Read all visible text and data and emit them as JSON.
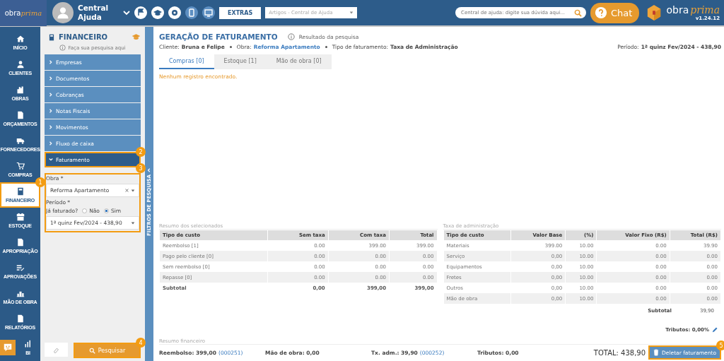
{
  "header": {
    "logo": {
      "part1": "obra",
      "part2": "prima"
    },
    "user": "Central Ajuda",
    "extras_button": "EXTRAS",
    "articles_select": {
      "placeholder": "Artigos - Central de Ajuda"
    },
    "help_search": {
      "placeholder": "Central de ajuda: digite sua dúvida aqui..."
    },
    "chat_button": "Chat",
    "brand": {
      "part1": "obra",
      "part2": "prima"
    },
    "version": "v1.24.12"
  },
  "nav": [
    {
      "label": "INÍCIO",
      "selected": false
    },
    {
      "label": "CLIENTES",
      "selected": false
    },
    {
      "label": "OBRAS",
      "selected": false
    },
    {
      "label": "ORÇAMENTOS",
      "selected": false
    },
    {
      "label": "FORNECEDORES",
      "selected": false
    },
    {
      "label": "COMPRAS",
      "selected": false
    },
    {
      "label": "FINANCEIRO",
      "selected": true,
      "callout": "1"
    },
    {
      "label": "ESTOQUE",
      "selected": false
    },
    {
      "label": "APROPRIAÇÃO",
      "selected": false
    },
    {
      "label": "APROVAÇÕES",
      "selected": false
    },
    {
      "label": "MÃO DE OBRA",
      "selected": false
    },
    {
      "label": "RELATÓRIOS",
      "selected": false
    },
    {
      "label": "BI",
      "selected": false
    }
  ],
  "sidebar": {
    "title": "FINANCEIRO",
    "hint": "Faça sua pesquisa aqui",
    "sections": [
      {
        "label": "Empresas",
        "expanded": false
      },
      {
        "label": "Documentos",
        "expanded": false
      },
      {
        "label": "Cobranças",
        "expanded": false
      },
      {
        "label": "Notas Fiscais",
        "expanded": false
      },
      {
        "label": "Movimentos",
        "expanded": false
      },
      {
        "label": "Fluxo de caixa",
        "expanded": false
      },
      {
        "label": "Faturamento",
        "expanded": true,
        "callout": "2"
      }
    ],
    "form": {
      "callout": "3",
      "obra_label": "Obra *",
      "obra_value": "Reforma Apartamento",
      "periodo_label": "Período *",
      "faturado_label": "Já faturado?",
      "faturado_options": [
        {
          "label": "Não",
          "selected": false
        },
        {
          "label": "Sim",
          "selected": true
        }
      ],
      "periodo_value": "1ª quinz Fev/2024 - 438,90"
    },
    "search_button": {
      "label": "Pesquisar",
      "callout": "4"
    },
    "side_tab": "FILTROS DE PESQUISA"
  },
  "main": {
    "title": "GERAÇÃO DE FATURAMENTO",
    "info": "Resultado da pesquisa",
    "meta": [
      {
        "label": "Cliente:",
        "value": "Bruna e Felipe",
        "link": false
      },
      {
        "label": "Obra:",
        "value": "Reforma Apartamento",
        "link": true
      },
      {
        "label": "Tipo de faturamento:",
        "value": "Taxa de Administração",
        "link": false
      }
    ],
    "period": {
      "label": "Período:",
      "value": "1ª quinz Fev/2024 - 438,90"
    },
    "tabs": [
      {
        "label": "Compras [0]",
        "selected": true
      },
      {
        "label": "Estoque [1]",
        "selected": false
      },
      {
        "label": "Mão de obra [0]",
        "selected": false
      }
    ],
    "empty_message": "Nenhum registro encontrado.",
    "summary": {
      "legend": "Resumo dos selecionados",
      "columns": [
        "Tipo de custo",
        "Sem taxa",
        "Com taxa",
        "Total"
      ],
      "rows": [
        {
          "kind": "item",
          "cells": [
            "Reembolso [1]",
            "0.00",
            "399.00",
            "399.00"
          ]
        },
        {
          "kind": "item",
          "cells": [
            "Pago pelo cliente [0]",
            "0.00",
            "0.00",
            "0.00"
          ]
        },
        {
          "kind": "item",
          "cells": [
            "Sem reembolso [0]",
            "0.00",
            "0.00",
            "0.00"
          ]
        },
        {
          "kind": "item",
          "cells": [
            "Repasse [0]",
            "0.00",
            "0.00",
            "0.00"
          ]
        },
        {
          "kind": "subtotal",
          "cells": [
            "Subtotal",
            "0,00",
            "399,00",
            "399,00"
          ]
        }
      ]
    },
    "admin": {
      "legend": "Taxa de administração",
      "columns": [
        "Tipo de custo",
        "Valor Base",
        "(%)",
        "Valor Fixo (R$)",
        "Total (R$)"
      ],
      "rows": [
        {
          "cells": [
            "Materiais",
            "399.00",
            "10.00",
            "0.00",
            "39.90"
          ]
        },
        {
          "cells": [
            "Serviço",
            "0,00",
            "10.00",
            "0.00",
            "0.00"
          ]
        },
        {
          "cells": [
            "Equipamentos",
            "0,00",
            "10.00",
            "0.00",
            "0.00"
          ]
        },
        {
          "cells": [
            "Fretes",
            "0,00",
            "10.00",
            "0.00",
            "0.00"
          ]
        },
        {
          "cells": [
            "Outros",
            "0,00",
            "10.00",
            "0.00",
            "0.00"
          ]
        },
        {
          "cells": [
            "Mão de obra",
            "0,00",
            "10.00",
            "0.00",
            "0.00"
          ]
        }
      ],
      "subtotal_label": "Subtotal",
      "subtotal_value": "39,90",
      "tributos": "Tributos: 0,00%"
    },
    "financial": {
      "legend": "Resumo financeiro",
      "items": [
        {
          "text": "Reembolso: 399,00",
          "ref": "(000251)"
        },
        {
          "text": "Mão de obra: 0,00"
        },
        {
          "text": "Tx. adm.: 39,90",
          "ref": "(000252)"
        },
        {
          "text": "Tributos: 0,00"
        }
      ],
      "total": "TOTAL: 438,90",
      "delete_button": {
        "label": "Deletar faturamento",
        "callout": "5"
      }
    }
  }
}
